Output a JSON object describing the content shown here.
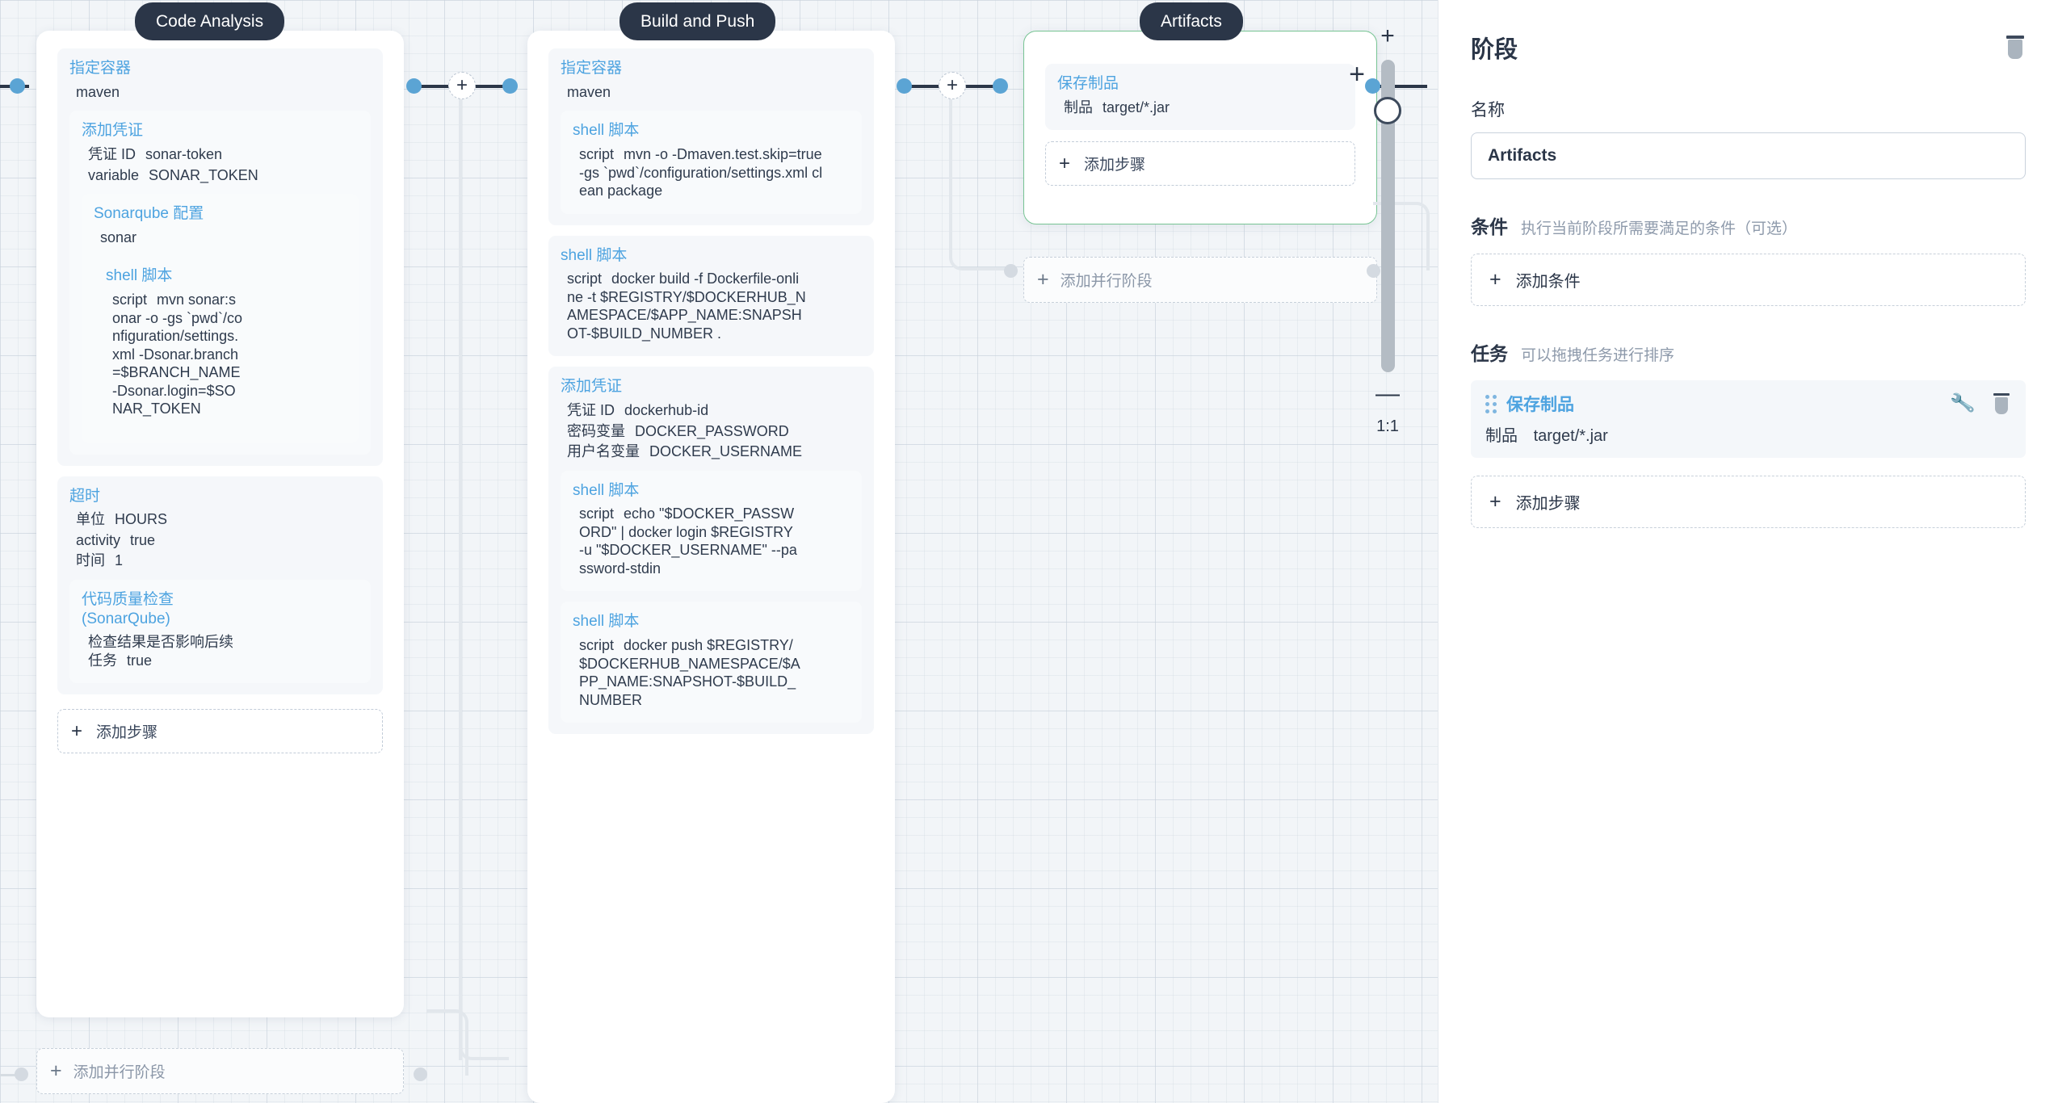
{
  "canvas": {
    "zoom_control": {
      "plus_label": "+",
      "minus_label": "—",
      "scale_label": "1:1"
    },
    "add_parallel_label": "添加并行阶段",
    "add_step_label": "添加步骤",
    "plus_label": "+"
  },
  "stages": [
    {
      "badge": "Code Analysis",
      "steps": [
        {
          "title": "指定容器",
          "rows": [
            {
              "k": "maven",
              "v": ""
            }
          ],
          "children": [
            {
              "title": "添加凭证",
              "rows": [
                {
                  "k": "凭证 ID",
                  "v": "sonar-token"
                },
                {
                  "k": "variable",
                  "v": "SONAR_TOKEN"
                }
              ],
              "children": [
                {
                  "title": "Sonarqube 配置",
                  "rows": [
                    {
                      "k": "sonar",
                      "v": ""
                    }
                  ],
                  "children": [
                    {
                      "title": "shell 脚本",
                      "rows": [
                        {
                          "k": "script",
                          "v": "mvn sonar:sonar -o -gs `pwd`/configuration/settings.xml -Dsonar.branch=$BRANCH_NAME -Dsonar.login=$SONAR_TOKEN"
                        }
                      ],
                      "children": []
                    }
                  ]
                }
              ]
            }
          ]
        },
        {
          "title": "超时",
          "rows": [
            {
              "k": "单位",
              "v": "HOURS"
            },
            {
              "k": "activity",
              "v": "true"
            },
            {
              "k": "时间",
              "v": "1"
            }
          ],
          "children": [
            {
              "title": "代码质量检查(SonarQube)",
              "rows": [
                {
                  "k": "检查结果是否影响后续任务",
                  "v": "true"
                }
              ],
              "children": []
            }
          ]
        }
      ]
    },
    {
      "badge": "Build and Push",
      "steps": [
        {
          "title": "指定容器",
          "rows": [
            {
              "k": "maven",
              "v": ""
            }
          ],
          "children": [
            {
              "title": "shell 脚本",
              "rows": [
                {
                  "k": "script",
                  "v": "mvn -o -Dmaven.test.skip=true -gs `pwd`/configuration/settings.xml clean package"
                }
              ],
              "children": []
            }
          ]
        },
        {
          "title": "shell 脚本",
          "rows": [
            {
              "k": "script",
              "v": "docker build -f Dockerfile-online -t $REGISTRY/$DOCKERHUB_NAMESPACE/$APP_NAME:SNAPSHOT-$BUILD_NUMBER ."
            }
          ],
          "children": []
        },
        {
          "title": "添加凭证",
          "rows": [
            {
              "k": "凭证 ID",
              "v": "dockerhub-id"
            },
            {
              "k": "密码变量",
              "v": "DOCKER_PASSWORD"
            },
            {
              "k": "用户名变量",
              "v": "DOCKER_USERNAME"
            }
          ],
          "children": [
            {
              "title": "shell 脚本",
              "rows": [
                {
                  "k": "script",
                  "v": "echo \"$DOCKER_PASSWORD\" | docker login $REGISTRY -u \"$DOCKER_USERNAME\" --password-stdin"
                }
              ],
              "children": []
            },
            {
              "title": "shell 脚本",
              "rows": [
                {
                  "k": "script",
                  "v": "docker push $REGISTRY/$DOCKERHUB_NAMESPACE/$APP_NAME:SNAPSHOT-$BUILD_NUMBER"
                }
              ],
              "children": []
            }
          ]
        }
      ]
    },
    {
      "badge": "Artifacts",
      "selected": true,
      "steps": [
        {
          "title": "保存制品",
          "rows": [
            {
              "k": "制品",
              "v": "target/*.jar"
            }
          ],
          "children": []
        }
      ]
    }
  ],
  "panel": {
    "title": "阶段",
    "name_label": "名称",
    "name_value": "Artifacts",
    "condition_title": "条件",
    "condition_desc": "执行当前阶段所需要満足的条件（可选）",
    "add_condition_label": "添加条件",
    "task_title": "任务",
    "task_desc": "可以拖拽任务进行排序",
    "task": {
      "name": "保存制品",
      "key": "制品",
      "value": "target/*.jar"
    },
    "add_step_label": "添加步骤",
    "plus_label": "+"
  },
  "colors": {
    "accent": "#4da3e0",
    "badge_bg": "#2b3648",
    "selected_border": "#77c493",
    "canvas_bg": "#f2f5f8"
  }
}
